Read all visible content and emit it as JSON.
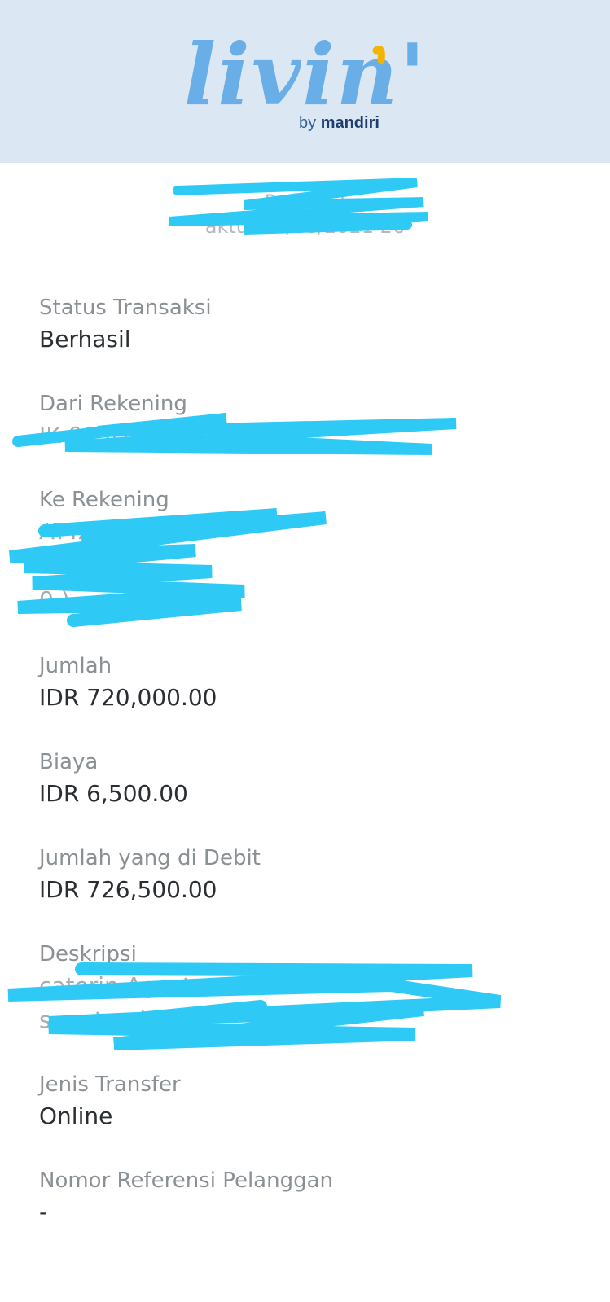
{
  "header": {
    "logo_text": "livin'",
    "logo_by": "by",
    "logo_brand": "mandiri",
    "colors": {
      "header_bg": "#dbe7f3",
      "logo_blue": "#6aaee8",
      "accent_yellow": "#f5b301",
      "scribble": "#2fc9f6"
    }
  },
  "meta": {
    "ref": "Ref: 202",
    "waktu": "aktu: 14/08/2021   26"
  },
  "fields": {
    "status": {
      "label": "Status Transaksi",
      "value": "Berhasil"
    },
    "dari": {
      "label": "Dari Rekening",
      "value": "IK                 00              IDR)"
    },
    "ke": {
      "label": "Ke Rekening",
      "value_line1": "                    ATTA",
      "value_line2": "0              )"
    },
    "jumlah": {
      "label": "Jumlah",
      "value": "IDR 720,000.00"
    },
    "biaya": {
      "label": "Biaya",
      "value": "IDR 6,500.00"
    },
    "debit": {
      "label": "Jumlah yang di Debit",
      "value": "IDR 726,500.00"
    },
    "deskripsi": {
      "label": "Deskripsi",
      "value_line1": "caterin                           Agustus",
      "value_line2": "s                 g         ptember"
    },
    "jenis": {
      "label": "Jenis Transfer",
      "value": "Online"
    },
    "nomor": {
      "label": "Nomor Referensi Pelanggan",
      "value": "-"
    }
  }
}
